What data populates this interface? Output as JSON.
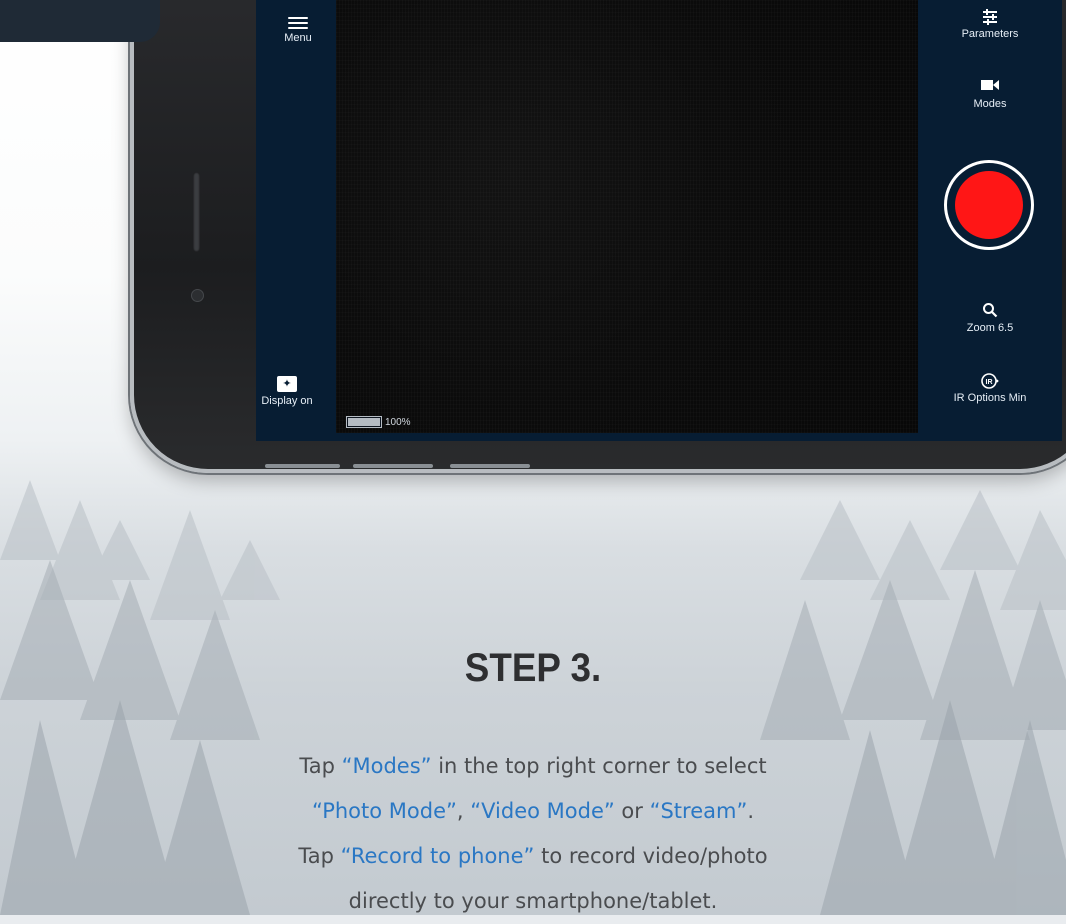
{
  "app": {
    "left_bar": {
      "menu_label": "Menu",
      "display_label": "Display on",
      "display_icon": "display-brightness-icon"
    },
    "status": {
      "battery_text": "100%",
      "battery_level": 1.0
    },
    "right_bar": {
      "parameters_label": "Parameters",
      "modes_label": "Modes",
      "zoom_label": "Zoom 6.5",
      "ir_label": "IR Options Min",
      "ir_icon_text": "IR"
    },
    "colors": {
      "panel": "#071d33",
      "record": "#ff1616",
      "highlight": "#2a77c4"
    }
  },
  "instructions": {
    "title": "STEP 3.",
    "line1": {
      "a": "Tap ",
      "b": "“Modes”",
      "c": " in the top right corner to select"
    },
    "line2": {
      "a": "“Photo Mode”",
      "b": ", ",
      "c": "“Video Mode”",
      "d": " or ",
      "e": "“Stream”",
      "f": "."
    },
    "line3": {
      "a": "Tap ",
      "b": "“Record to phone”",
      "c": " to record video/photo"
    },
    "line4": "directly to your smartphone/tablet."
  }
}
